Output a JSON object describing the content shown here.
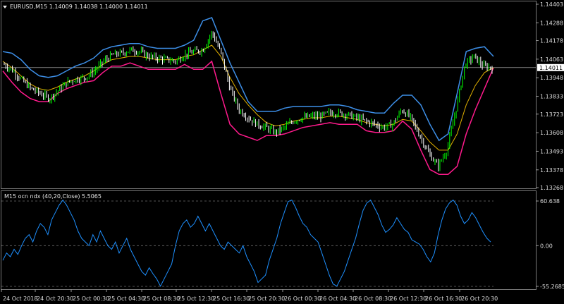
{
  "header": {
    "symbol_line": "EURUSD,M15  1.14009 1.14038 1.14000 1.14011",
    "menu_icon": "triangle-down-icon"
  },
  "indicator": {
    "label": "M15   ocn ndx (40,20,Close) 5.5065"
  },
  "colors": {
    "background": "#000000",
    "bull_bar": "#00ff00",
    "bear_bar": "#ffffff",
    "upper_band": "#3d8fe8",
    "lower_band": "#ff1a8c",
    "mid_ma": "#e0b000",
    "oscillator": "#1e90ff",
    "current_price_box": "#ffffff"
  },
  "chart_data": [
    {
      "type": "candlestick",
      "ylim": [
        1.13268,
        1.14403
      ],
      "y_ticks": [
        "1.14403",
        "1.14288",
        "1.14178",
        "1.14063",
        "1.13948",
        "1.13833",
        "1.13723",
        "1.13608",
        "1.13493",
        "1.13378",
        "1.13268"
      ],
      "current_price": "1.14011",
      "x_ticks": [
        "24 Oct 2018",
        "24 Oct 20:30",
        "25 Oct 00:30",
        "25 Oct 04:30",
        "25 Oct 08:30",
        "25 Oct 12:30",
        "25 Oct 16:30",
        "25 Oct 20:30",
        "26 Oct 00:30",
        "26 Oct 04:30",
        "26 Oct 08:30",
        "26 Oct 12:30",
        "26 Oct 16:30",
        "26 Oct 20:30"
      ],
      "close_series": [
        1.1403,
        1.1399,
        1.1393,
        1.1388,
        1.1385,
        1.1382,
        1.1387,
        1.1392,
        1.1394,
        1.1395,
        1.1399,
        1.1405,
        1.1409,
        1.141,
        1.1412,
        1.1411,
        1.1408,
        1.1407,
        1.1406,
        1.1405,
        1.1409,
        1.1411,
        1.1412,
        1.1423,
        1.141,
        1.1388,
        1.1375,
        1.137,
        1.1366,
        1.1364,
        1.1361,
        1.1364,
        1.1368,
        1.137,
        1.1371,
        1.1371,
        1.1373,
        1.1373,
        1.1372,
        1.137,
        1.1368,
        1.1366,
        1.1364,
        1.1366,
        1.1375,
        1.137,
        1.1359,
        1.1348,
        1.134,
        1.135,
        1.1375,
        1.1403,
        1.1408,
        1.1402,
        1.1401
      ],
      "series": [
        {
          "values": [
            1.1411,
            1.141,
            1.1406,
            1.14,
            1.1396,
            1.1395,
            1.1396,
            1.1399,
            1.1402,
            1.1404,
            1.1407,
            1.1412,
            1.1414,
            1.1415,
            1.1416,
            1.1416,
            1.1414,
            1.1413,
            1.1413,
            1.1413,
            1.1415,
            1.1418,
            1.143,
            1.1432,
            1.1418,
            1.1404,
            1.1392,
            1.138,
            1.1374,
            1.1374,
            1.1374,
            1.1376,
            1.1377,
            1.1377,
            1.1377,
            1.1377,
            1.1378,
            1.1378,
            1.1377,
            1.1375,
            1.1374,
            1.1373,
            1.1373,
            1.1379,
            1.1384,
            1.1384,
            1.1378,
            1.1366,
            1.1356,
            1.136,
            1.1385,
            1.1411,
            1.1413,
            1.1414,
            1.1408
          ]
        },
        {
          "values": [
            1.1399,
            1.1392,
            1.1386,
            1.1382,
            1.138,
            1.138,
            1.1385,
            1.1388,
            1.139,
            1.1392,
            1.1393,
            1.1398,
            1.1402,
            1.1402,
            1.1404,
            1.1402,
            1.14,
            1.14,
            1.14,
            1.14,
            1.1403,
            1.14,
            1.14,
            1.1405,
            1.1385,
            1.1366,
            1.136,
            1.1358,
            1.1356,
            1.1359,
            1.1359,
            1.136,
            1.1362,
            1.1364,
            1.1365,
            1.1366,
            1.1367,
            1.1366,
            1.1366,
            1.1366,
            1.1362,
            1.1361,
            1.1361,
            1.1362,
            1.1368,
            1.1363,
            1.135,
            1.1338,
            1.1335,
            1.1335,
            1.134,
            1.136,
            1.1375,
            1.1388,
            1.1401
          ]
        },
        {
          "values": [
            1.1405,
            1.1401,
            1.1396,
            1.1391,
            1.1388,
            1.1387,
            1.1389,
            1.1392,
            1.1394,
            1.1396,
            1.1399,
            1.1403,
            1.1406,
            1.1407,
            1.1408,
            1.1408,
            1.1407,
            1.1406,
            1.1406,
            1.1406,
            1.1408,
            1.1409,
            1.1412,
            1.1415,
            1.1408,
            1.1395,
            1.1385,
            1.1378,
            1.1372,
            1.1367,
            1.1365,
            1.1366,
            1.1368,
            1.1369,
            1.137,
            1.137,
            1.1371,
            1.1371,
            1.137,
            1.1369,
            1.1367,
            1.1366,
            1.1365,
            1.1366,
            1.1369,
            1.1368,
            1.1362,
            1.1355,
            1.135,
            1.135,
            1.136,
            1.1378,
            1.139,
            1.1398,
            1.1401
          ]
        }
      ]
    },
    {
      "type": "line",
      "ylim": [
        -55.2685,
        60.638
      ],
      "y_ticks": [
        "60.638",
        "0.00",
        "-55.2685"
      ],
      "series": [
        {
          "values": [
            -20,
            -10,
            -15,
            -5,
            -12,
            0,
            10,
            15,
            5,
            20,
            30,
            25,
            15,
            35,
            45,
            55,
            62,
            55,
            45,
            35,
            20,
            10,
            5,
            0,
            15,
            5,
            20,
            10,
            0,
            -5,
            5,
            -10,
            0,
            10,
            -5,
            -15,
            -25,
            -35,
            -40,
            -30,
            -38,
            -45,
            -55,
            -45,
            -35,
            -25,
            0,
            20,
            30,
            35,
            25,
            30,
            40,
            30,
            20,
            30,
            20,
            10,
            0,
            -5,
            5,
            0,
            -5,
            -10,
            0,
            -15,
            -25,
            -35,
            -50,
            -45,
            -40,
            -20,
            -5,
            10,
            30,
            45,
            60,
            62,
            52,
            40,
            30,
            25,
            15,
            10,
            5,
            -10,
            -25,
            -40,
            -52,
            -55,
            -45,
            -35,
            -20,
            -5,
            10,
            30,
            48,
            58,
            62,
            52,
            42,
            28,
            18,
            22,
            28,
            38,
            30,
            22,
            18,
            8,
            5,
            2,
            -5,
            -15,
            -22,
            -10,
            15,
            35,
            50,
            58,
            62,
            55,
            40,
            30,
            35,
            45,
            38,
            28,
            18,
            10,
            5
          ]
        }
      ]
    }
  ]
}
